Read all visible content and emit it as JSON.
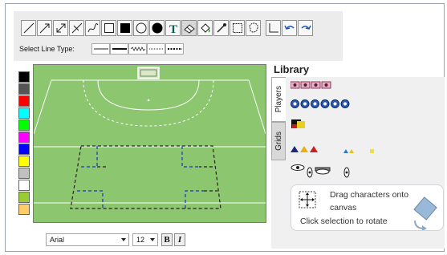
{
  "toolbar": {
    "tools": [
      {
        "name": "line-tool-icon"
      },
      {
        "name": "arrow-tool-icon"
      },
      {
        "name": "double-arrow-tool-icon"
      },
      {
        "name": "crossed-line-tool-icon"
      },
      {
        "name": "freehand-curve-tool-icon"
      },
      {
        "name": "hollow-square-tool-icon"
      },
      {
        "name": "filled-square-tool-icon"
      },
      {
        "name": "hollow-circle-tool-icon"
      },
      {
        "name": "filled-circle-tool-icon"
      },
      {
        "name": "text-tool-icon"
      },
      {
        "name": "eraser-tool-icon"
      },
      {
        "name": "fill-bucket-tool-icon"
      },
      {
        "name": "eyedropper-tool-icon"
      },
      {
        "name": "rectangle-select-tool-icon"
      },
      {
        "name": "lasso-select-tool-icon"
      },
      {
        "name": "corner-tool-icon"
      },
      {
        "name": "undo-icon"
      },
      {
        "name": "redo-icon"
      }
    ],
    "line_type_label": "Select Line Type:",
    "line_types": [
      "solid-thin",
      "solid-thick",
      "zigzag",
      "dotted-thin",
      "dotted-thick"
    ]
  },
  "palette": {
    "colors": [
      "#000000",
      "#555555",
      "#ff0000",
      "#00ffff",
      "#00ff00",
      "#ff00ff",
      "#0000ff",
      "#ffff00",
      "#c0c0c0",
      "#ffffff",
      "#99cc33",
      "#ffcc66"
    ]
  },
  "pitch": {
    "grass": "#8cc66e",
    "line_color": "#ffffff",
    "grid_black": "#222222",
    "grid_blue": "#1a33cc"
  },
  "font_bar": {
    "font_family": "Arial",
    "font_size": "12",
    "bold": "B",
    "italic": "I"
  },
  "library": {
    "title": "Library",
    "tab_players": "Players",
    "tab_grids": "Grids",
    "hint_line1": "Drag characters onto",
    "hint_line2": "canvas",
    "hint_line3": "Click selection to rotate"
  }
}
